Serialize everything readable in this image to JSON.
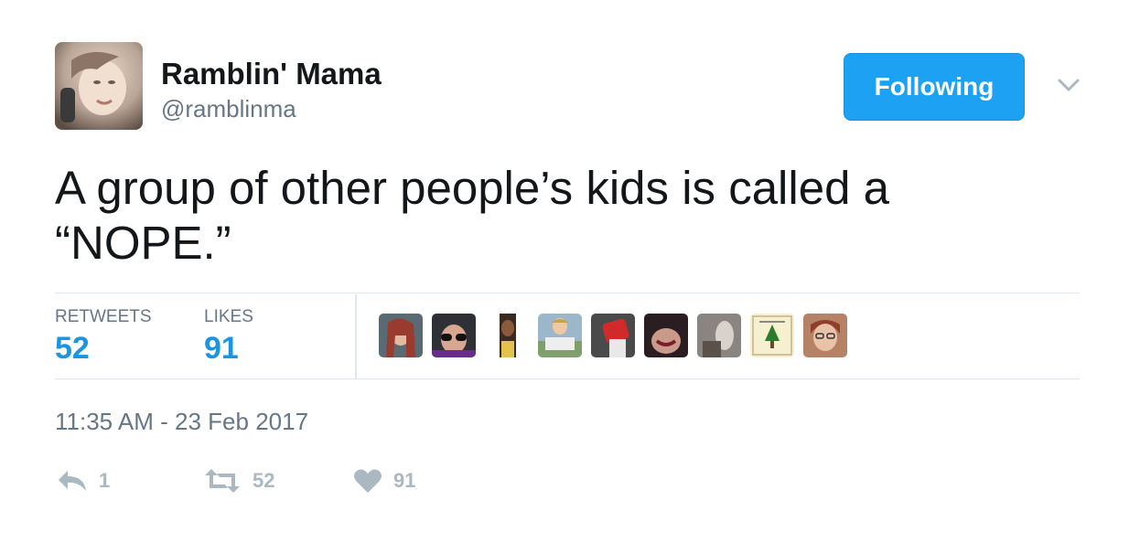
{
  "tweet": {
    "display_name": "Ramblin' Mama",
    "handle": "@ramblinma",
    "follow_button": "Following",
    "text_line1": "A group of other people’s kids is called a",
    "text_line2": "“NOPE.”",
    "stats": {
      "retweets_label": "RETWEETS",
      "retweets_value": "52",
      "likes_label": "LIKES",
      "likes_value": "91"
    },
    "timestamp": "11:35 AM - 23 Feb 2017",
    "actions": {
      "reply_count": "1",
      "retweet_count": "52",
      "like_count": "91"
    }
  },
  "colors": {
    "accent": "#1da1f2",
    "stat_value": "#1b95e0",
    "muted": "#657786",
    "action_icon": "#aab8c2"
  },
  "icons": [
    "user-avatar",
    "chevron-down-icon",
    "reply-icon",
    "retweet-icon",
    "heart-icon"
  ]
}
